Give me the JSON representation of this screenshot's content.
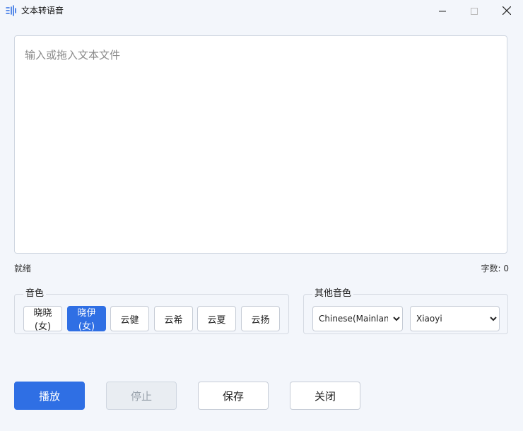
{
  "window": {
    "title": "文本转语音",
    "accent": "#2f6fe4"
  },
  "editor": {
    "placeholder": "输入或拖入文本文件",
    "value": ""
  },
  "status": {
    "state": "就绪",
    "char_count_label": "字数: ",
    "char_count": "0"
  },
  "voice_group": {
    "label": "音色",
    "voices": [
      "晓晓(女)",
      "晓伊(女)",
      "云健",
      "云希",
      "云夏",
      "云扬"
    ],
    "selected": "晓伊(女)"
  },
  "other_group": {
    "label": "其他音色",
    "language_selected": "Chinese(Mainland)",
    "voice_selected": "Xiaoyi"
  },
  "actions": {
    "play": "播放",
    "stop": "停止",
    "save": "保存",
    "close": "关闭"
  }
}
